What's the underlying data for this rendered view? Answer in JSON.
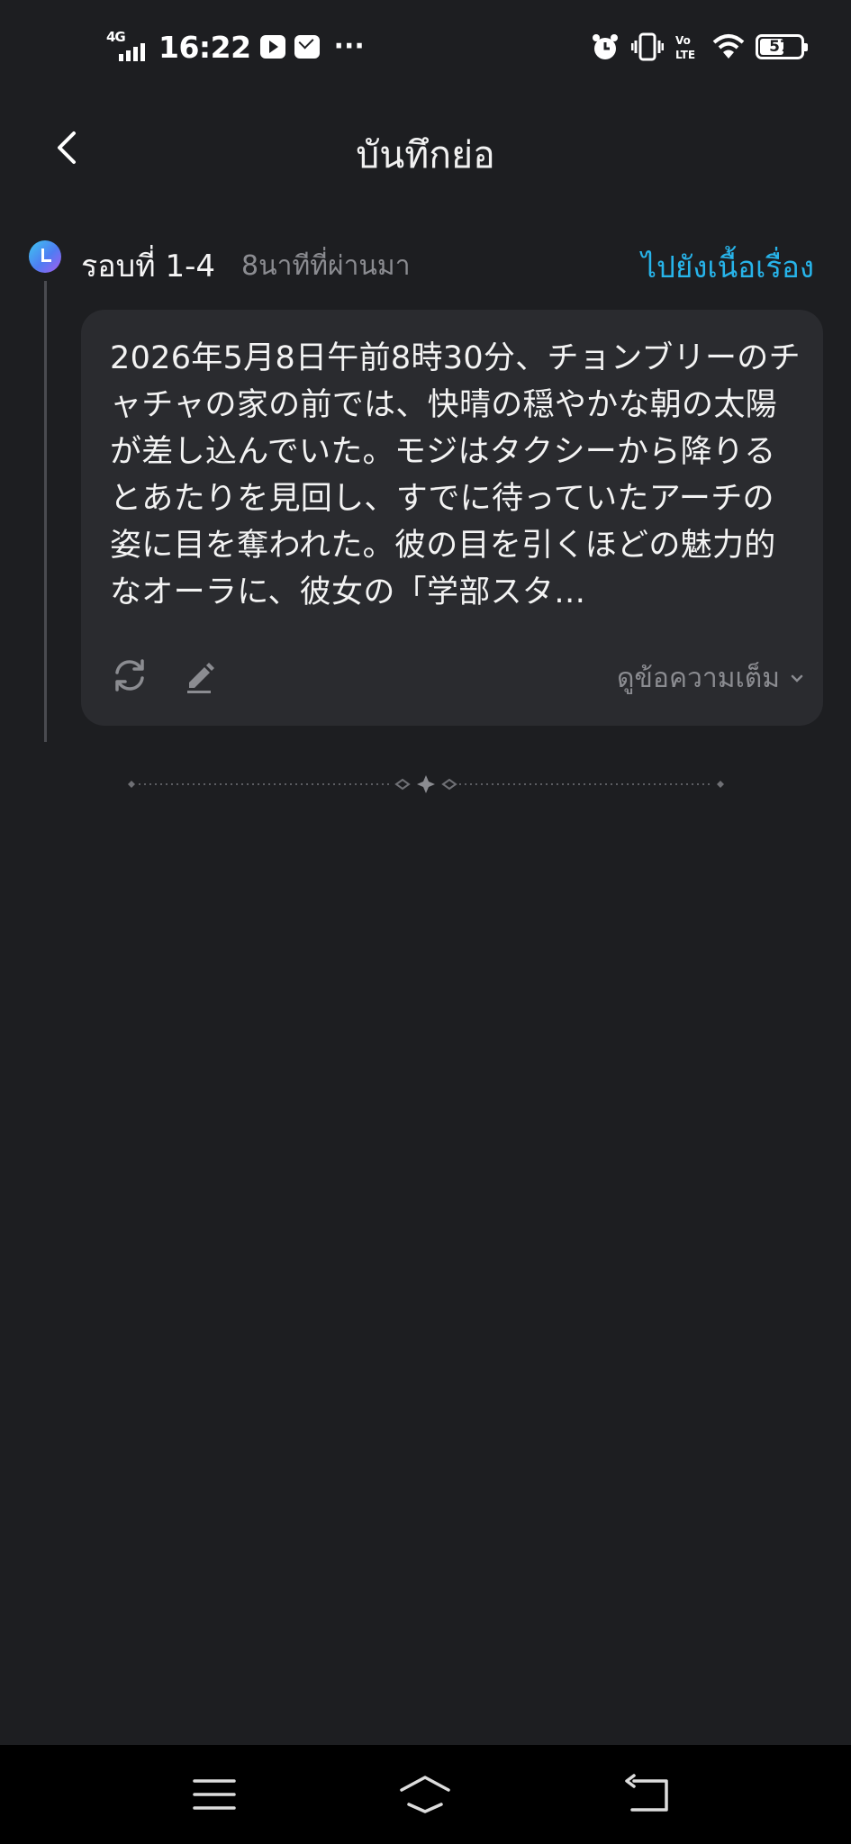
{
  "status_bar": {
    "network": "4G",
    "time": "16:22",
    "more": "···",
    "battery_level": "57"
  },
  "header": {
    "title": "บันทึกย่อ"
  },
  "entry": {
    "round_label": "รอบที่ 1-4",
    "time_ago": "8นาทีที่ผ่านมา",
    "go_to_story": "ไปยังเนื้อเรื่อง",
    "summary_text": "2026年5月8日午前8時30分、チョンブリーのチャチャの家の前では、快晴の穏やかな朝の太陽が差し込んでいた。モジはタクシーから降りるとあたりを見回し、すでに待っていたアーチの姿に目を奪われた。彼の目を引くほどの魅力的なオーラに、彼女の「学部スタ…",
    "view_full": "ดูข้อความเต็ม"
  },
  "icons": {
    "back": "chevron-left-icon",
    "refresh": "refresh-icon",
    "edit": "pencil-icon",
    "expand": "chevron-down-icon",
    "nav_menu": "menu-icon",
    "nav_home": "home-icon",
    "nav_back": "back-icon"
  },
  "colors": {
    "background": "#1d1e21",
    "card": "#2a2b2f",
    "accent": "#27b4ea",
    "muted_text": "#8b8c91"
  }
}
